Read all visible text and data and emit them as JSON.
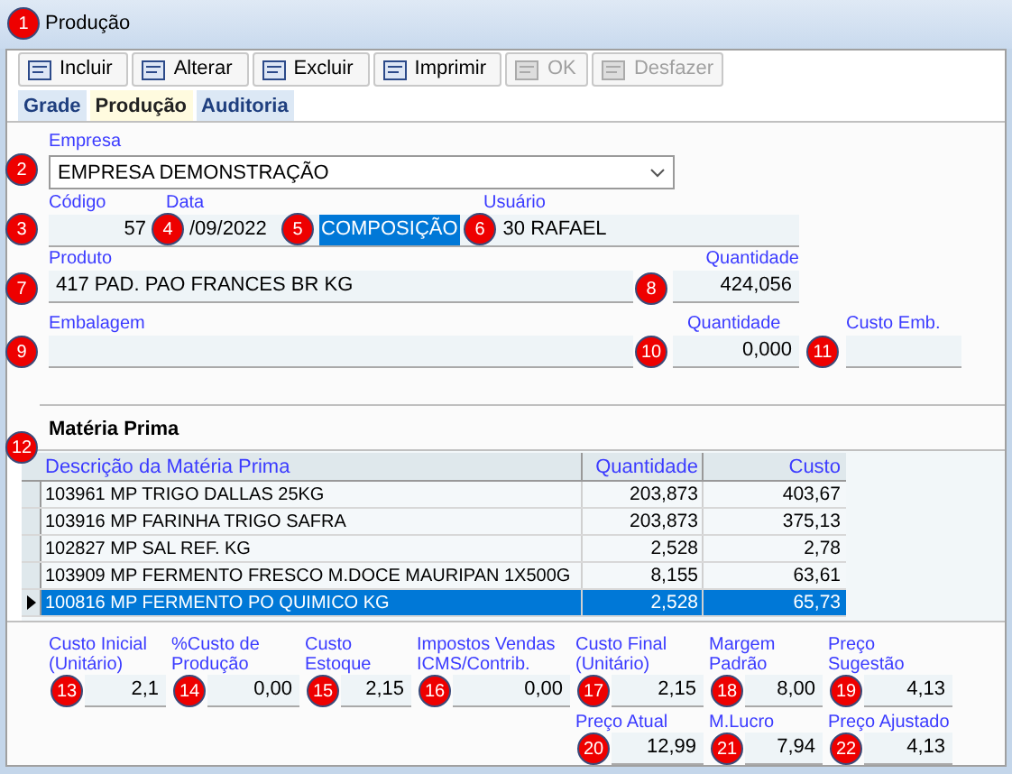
{
  "window": {
    "title": "Produção"
  },
  "toolbar": [
    {
      "label": "Incluir",
      "disabled": false
    },
    {
      "label": "Alterar",
      "disabled": false
    },
    {
      "label": "Excluir",
      "disabled": false
    },
    {
      "label": "Imprimir",
      "disabled": false
    },
    {
      "label": "OK",
      "disabled": true
    },
    {
      "label": "Desfazer",
      "disabled": true
    }
  ],
  "tabs": [
    {
      "label": "Grade",
      "selected": false
    },
    {
      "label": "Produção",
      "selected": true
    },
    {
      "label": "Auditoria",
      "selected": false
    }
  ],
  "empresa": {
    "label": "Empresa",
    "value": "EMPRESA DEMONSTRAÇÃO"
  },
  "header_fields": [
    {
      "label": "Código",
      "value": "57"
    },
    {
      "label": "Data",
      "value": "/09/2022"
    },
    {
      "value": "COMPOSIÇÃO"
    },
    {
      "label": "Usuário",
      "value": "30 RAFAEL"
    }
  ],
  "produto": {
    "label": "Produto",
    "value": "417 PAD. PAO FRANCES BR KG",
    "qty_label": "Quantidade",
    "qty": "424,056"
  },
  "embalagem": {
    "label": "Embalagem",
    "qty_label": "Quantidade",
    "qty": "0,000",
    "cost_label": "Custo Emb."
  },
  "materia_prima": {
    "title": "Matéria Prima",
    "columns": [
      "Descrição da Matéria Prima",
      "Quantidade",
      "Custo"
    ],
    "rows": [
      {
        "cells": [
          "103961 MP TRIGO DALLAS 25KG",
          "203,873",
          "403,67"
        ],
        "selected": false
      },
      {
        "cells": [
          "103916 MP FARINHA TRIGO SAFRA",
          "203,873",
          "375,13"
        ],
        "selected": false
      },
      {
        "cells": [
          "102827 MP SAL REF. KG",
          "2,528",
          "2,78"
        ],
        "selected": false
      },
      {
        "cells": [
          "103909 MP FERMENTO FRESCO M.DOCE MAURIPAN 1X500G",
          "8,155",
          "63,61"
        ],
        "selected": false
      },
      {
        "cells": [
          "100816 MP FERMENTO PO QUIMICO KG",
          "2,528",
          "65,73"
        ],
        "selected": true
      }
    ]
  },
  "costs_row1": [
    {
      "label": "Custo Inicial (Unitário)",
      "value": "2,1"
    },
    {
      "label": "%Custo de Produção",
      "value": "0,00"
    },
    {
      "label": "Custo Estoque",
      "value": "2,15"
    },
    {
      "label": "Impostos Vendas ICMS/Contrib.",
      "value": "0,00"
    },
    {
      "label": "Custo Final (Unitário)",
      "value": "2,15"
    },
    {
      "label": "Margem Padrão",
      "value": "8,00"
    },
    {
      "label": "Preço Sugestão",
      "value": "4,13"
    }
  ],
  "costs_row2": [
    {
      "label": "Preço Atual",
      "value": "12,99"
    },
    {
      "label": "M.Lucro",
      "value": "7,94"
    },
    {
      "label": "Preço Ajustado",
      "value": "4,13"
    }
  ],
  "markers": [
    "1",
    "2",
    "3",
    "4",
    "5",
    "6",
    "7",
    "8",
    "9",
    "10",
    "11",
    "12",
    "13",
    "14",
    "15",
    "16",
    "17",
    "18",
    "19",
    "20",
    "21",
    "22"
  ]
}
